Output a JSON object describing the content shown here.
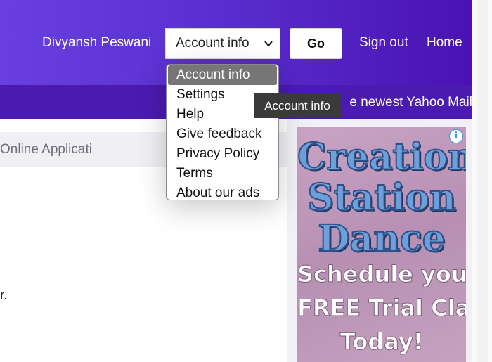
{
  "header": {
    "user_name": "Divyansh Peswani",
    "account_select": {
      "selected": "Account info"
    },
    "go_label": "Go",
    "sign_out": "Sign out",
    "home": "Home",
    "subbar_text": "e newest Yahoo Mail"
  },
  "dropdown": {
    "options": [
      "Account info",
      "Settings",
      "Help",
      "Give feedback",
      "Privacy Policy",
      "Terms",
      "About our ads"
    ]
  },
  "tooltip": "Account info",
  "content": {
    "gray_box_text": "Online Applicati",
    "fragment": "r."
  },
  "ad": {
    "info_icon": "info-icon",
    "title_lines": [
      "Creation",
      "Station",
      "Dance"
    ],
    "sub_lines": [
      "Schedule your",
      "FREE Trial Class",
      "Today!"
    ]
  },
  "colors": {
    "header_start": "#6a3fe0",
    "header_end": "#4a12b3",
    "subbar": "#4b1ab0",
    "dropdown_active": "#767676"
  }
}
